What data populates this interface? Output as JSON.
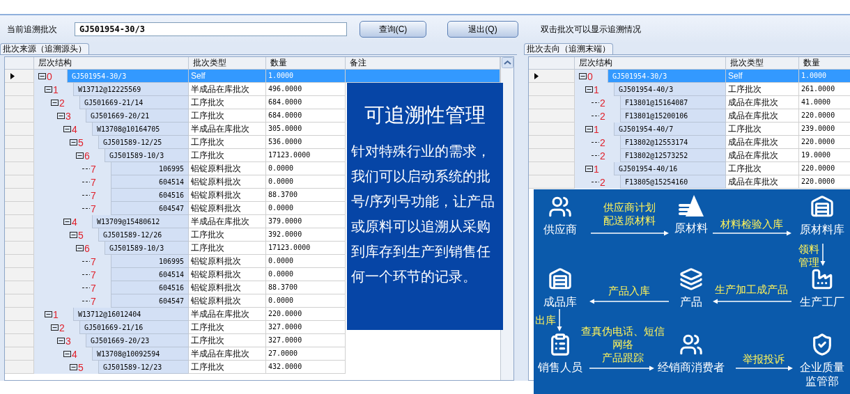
{
  "toolbar": {
    "label": "当前追溯批次",
    "batch_field": {
      "value": "GJ501954-30/3"
    },
    "buttons": [
      "查询(C)",
      "退出(Q)"
    ],
    "hint": "双击批次可以显示追溯情况"
  },
  "source_panel": {
    "tab": "批次来源（追溯源头）",
    "columns": [
      "层次结构",
      "批次类型",
      "数量",
      "备注"
    ],
    "rows": [
      {
        "tier": "0",
        "batch": "GJ501954-30/3",
        "type": "Self",
        "quantity": "1.0000",
        "kind": "batch",
        "selected": true,
        "expanded": true,
        "children": [
          {
            "tier": "1",
            "batch": "W13712@12225569",
            "type": "半成品在库批次",
            "quantity": "496.0000",
            "kind": "batch",
            "selected": false,
            "expanded": true,
            "children": [
              {
                "tier": "2",
                "batch": "GJ501669-21/14",
                "type": "工序批次",
                "quantity": "684.0000",
                "kind": "batch",
                "selected": false,
                "expanded": true,
                "children": [
                  {
                    "tier": "3",
                    "batch": "GJ501669-20/21",
                    "type": "工序批次",
                    "quantity": "684.0000",
                    "kind": "batch",
                    "selected": false,
                    "expanded": true,
                    "children": [
                      {
                        "tier": "4",
                        "batch": "W13708@10164705",
                        "type": "半成品在库批次",
                        "quantity": "305.0000",
                        "kind": "batch",
                        "selected": false,
                        "expanded": true,
                        "children": [
                          {
                            "tier": "5",
                            "batch": "GJ501589-12/25",
                            "type": "工序批次",
                            "quantity": "536.0000",
                            "kind": "batch",
                            "selected": false,
                            "expanded": true,
                            "children": [
                              {
                                "tier": "6",
                                "batch": "GJ501589-10/3",
                                "type": "工序批次",
                                "quantity": "17123.0000",
                                "kind": "batch",
                                "selected": false,
                                "expanded": true,
                                "children": [
                                  {
                                    "tier": "7",
                                    "batch": "106995",
                                    "type": "铝锭原料批次",
                                    "quantity": "0.0000",
                                    "kind": "material",
                                    "selected": false
                                  },
                                  {
                                    "tier": "7",
                                    "batch": "604514",
                                    "type": "铝锭原料批次",
                                    "quantity": "0.0000",
                                    "kind": "material",
                                    "selected": false
                                  },
                                  {
                                    "tier": "7",
                                    "batch": "604516",
                                    "type": "铝锭原料批次",
                                    "quantity": "88.3700",
                                    "kind": "material",
                                    "selected": false
                                  },
                                  {
                                    "tier": "7",
                                    "batch": "604547",
                                    "type": "铝锭原料批次",
                                    "quantity": "0.0000",
                                    "kind": "material",
                                    "selected": false
                                  }
                                ]
                              }
                            ]
                          }
                        ]
                      },
                      {
                        "tier": "4",
                        "batch": "W13709@15480612",
                        "type": "半成品在库批次",
                        "quantity": "379.0000",
                        "kind": "batch",
                        "selected": false,
                        "expanded": true,
                        "children": [
                          {
                            "tier": "5",
                            "batch": "GJ501589-12/26",
                            "type": "工序批次",
                            "quantity": "392.0000",
                            "kind": "batch",
                            "selected": false,
                            "expanded": true,
                            "children": [
                              {
                                "tier": "6",
                                "batch": "GJ501589-10/3",
                                "type": "工序批次",
                                "quantity": "17123.0000",
                                "kind": "batch",
                                "selected": false,
                                "expanded": true,
                                "children": [
                                  {
                                    "tier": "7",
                                    "batch": "106995",
                                    "type": "铝锭原料批次",
                                    "quantity": "0.0000",
                                    "kind": "material",
                                    "selected": false
                                  },
                                  {
                                    "tier": "7",
                                    "batch": "604514",
                                    "type": "铝锭原料批次",
                                    "quantity": "0.0000",
                                    "kind": "material",
                                    "selected": false
                                  },
                                  {
                                    "tier": "7",
                                    "batch": "604516",
                                    "type": "铝锭原料批次",
                                    "quantity": "88.3700",
                                    "kind": "material",
                                    "selected": false
                                  },
                                  {
                                    "tier": "7",
                                    "batch": "604547",
                                    "type": "铝锭原料批次",
                                    "quantity": "0.0000",
                                    "kind": "material",
                                    "selected": false
                                  }
                                ]
                              }
                            ]
                          }
                        ]
                      }
                    ]
                  }
                ]
              }
            ]
          },
          {
            "tier": "1",
            "batch": "W13712@16012404",
            "type": "半成品在库批次",
            "quantity": "220.0000",
            "kind": "batch",
            "selected": false,
            "expanded": true,
            "children": [
              {
                "tier": "2",
                "batch": "GJ501669-21/16",
                "type": "工序批次",
                "quantity": "327.0000",
                "kind": "batch",
                "selected": false,
                "expanded": true,
                "children": [
                  {
                    "tier": "3",
                    "batch": "GJ501669-20/23",
                    "type": "工序批次",
                    "quantity": "327.0000",
                    "kind": "batch",
                    "selected": false,
                    "expanded": true,
                    "children": [
                      {
                        "tier": "4",
                        "batch": "W13708@10092594",
                        "type": "半成品在库批次",
                        "quantity": "27.0000",
                        "kind": "batch",
                        "selected": false,
                        "expanded": true,
                        "children": [
                          {
                            "tier": "5",
                            "batch": "GJ501589-12/23",
                            "type": "工序批次",
                            "quantity": "432.0000",
                            "kind": "batch",
                            "selected": false,
                            "expanded": true
                          }
                        ]
                      }
                    ]
                  }
                ]
              }
            ]
          }
        ]
      }
    ]
  },
  "destination_panel": {
    "tab": "批次去向（追溯末端）",
    "columns": [
      "层次结构",
      "批次类型",
      "数量"
    ],
    "rows": [
      {
        "tier": "0",
        "batch": "GJ501954-30/3",
        "type": "Self",
        "quantity": "1.0000",
        "kind": "batch",
        "selected": true,
        "expanded": true,
        "children": [
          {
            "tier": "1",
            "batch": "GJ501954-40/3",
            "type": "工序批次",
            "quantity": "261.0000",
            "kind": "batch",
            "selected": false,
            "expanded": true,
            "children": [
              {
                "tier": "2",
                "batch": "F13801@15164087",
                "type": "成品在库批次",
                "quantity": "41.0000",
                "kind": "batch",
                "selected": false
              },
              {
                "tier": "2",
                "batch": "F13801@15200106",
                "type": "成品在库批次",
                "quantity": "220.0000",
                "kind": "batch",
                "selected": false
              }
            ]
          },
          {
            "tier": "1",
            "batch": "GJ501954-40/7",
            "type": "工序批次",
            "quantity": "239.0000",
            "kind": "batch",
            "selected": false,
            "expanded": true,
            "children": [
              {
                "tier": "2",
                "batch": "F13802@12553174",
                "type": "成品在库批次",
                "quantity": "220.0000",
                "kind": "batch",
                "selected": false
              },
              {
                "tier": "2",
                "batch": "F13802@12573252",
                "type": "成品在库批次",
                "quantity": "19.0000",
                "kind": "batch",
                "selected": false
              }
            ]
          },
          {
            "tier": "1",
            "batch": "GJ501954-40/16",
            "type": "工序批次",
            "quantity": "220.0000",
            "kind": "batch",
            "selected": false,
            "expanded": true,
            "children": [
              {
                "tier": "2",
                "batch": "F13805@15254160",
                "type": "成品在库批次",
                "quantity": "220.0000",
                "kind": "batch",
                "selected": false
              }
            ]
          }
        ]
      }
    ]
  },
  "feature_card": {
    "title": "可追溯性管理",
    "body": "针对特殊行业的需求，我们可以启动系统的批号/序列号功能，让产品或原料可以追溯从采购到库存到生产到销售任何一个环节的记录。"
  },
  "flow_diagram": {
    "nodes": [
      {
        "label": "供应商",
        "kind": "people"
      },
      {
        "label": "原材料",
        "kind": "material"
      },
      {
        "label": "原材料库",
        "kind": "warehouse"
      },
      {
        "label": "成品库",
        "kind": "warehouse"
      },
      {
        "label": "产品",
        "kind": "layers"
      },
      {
        "label": "生产工厂",
        "kind": "factory"
      },
      {
        "label": "销售人员",
        "kind": "clipboard"
      },
      {
        "label": "经销商消费者",
        "kind": "people"
      },
      {
        "label": "企业质量监管部",
        "kind": "shield"
      }
    ],
    "edges": [
      {
        "label": [
          "供应商计划",
          "配送原材料"
        ]
      },
      {
        "label": [
          "材料检验入库"
        ]
      },
      {
        "label": [
          "领料",
          "管理"
        ]
      },
      {
        "label": [
          "产品入库"
        ]
      },
      {
        "label": [
          "生产加工成产品"
        ]
      },
      {
        "label": [
          "出库"
        ]
      },
      {
        "label": [
          "查真伪电话、短信",
          "网络",
          "产品跟踪"
        ]
      },
      {
        "label": [
          "举报投诉"
        ]
      }
    ]
  }
}
